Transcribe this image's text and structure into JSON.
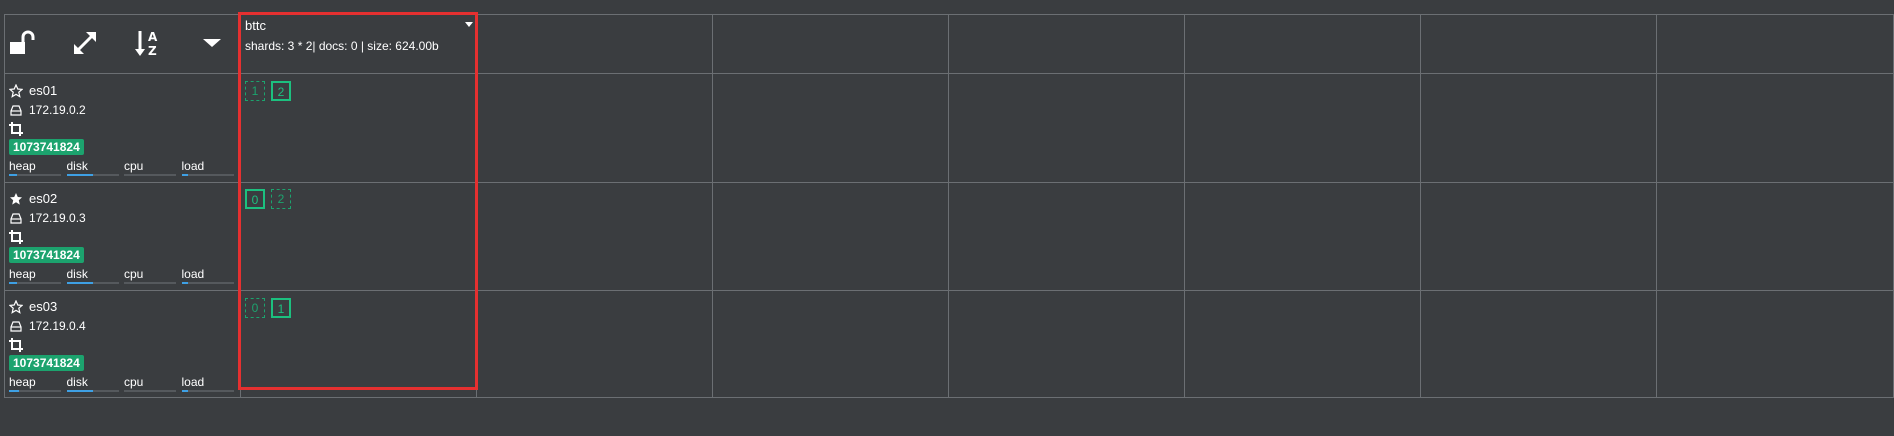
{
  "toolbar": {
    "lock_icon": "unlock-icon",
    "expand_icon": "expand-icon",
    "sort_icon": "sort-az-icon",
    "dropdown_icon": "caret-down-icon"
  },
  "index": {
    "name": "bttc",
    "meta": "shards: 3 * 2| docs: 0 | size: 624.00b"
  },
  "nodes": [
    {
      "name": "es01",
      "master": false,
      "ip": "172.19.0.2",
      "memory": "1073741824",
      "stats": [
        {
          "label": "heap",
          "level": 0.15
        },
        {
          "label": "disk",
          "level": 0.5
        },
        {
          "label": "cpu",
          "level": 0
        },
        {
          "label": "load",
          "level": 0.12
        }
      ],
      "shards": [
        {
          "label": "1",
          "type": "replica"
        },
        {
          "label": "2",
          "type": "primary"
        }
      ]
    },
    {
      "name": "es02",
      "master": true,
      "ip": "172.19.0.3",
      "memory": "1073741824",
      "stats": [
        {
          "label": "heap",
          "level": 0.15
        },
        {
          "label": "disk",
          "level": 0.5
        },
        {
          "label": "cpu",
          "level": 0
        },
        {
          "label": "load",
          "level": 0.12
        }
      ],
      "shards": [
        {
          "label": "0",
          "type": "primary"
        },
        {
          "label": "2",
          "type": "replica"
        }
      ]
    },
    {
      "name": "es03",
      "master": false,
      "ip": "172.19.0.4",
      "memory": "1073741824",
      "stats": [
        {
          "label": "heap",
          "level": 0.2
        },
        {
          "label": "disk",
          "level": 0.5
        },
        {
          "label": "cpu",
          "level": 0
        },
        {
          "label": "load",
          "level": 0.12
        }
      ],
      "shards": [
        {
          "label": "0",
          "type": "replica"
        },
        {
          "label": "1",
          "type": "primary"
        }
      ]
    }
  ],
  "colors": {
    "background": "#3a3d40",
    "primary_shard": "#1cc07f",
    "memory_badge": "#1ca36e",
    "stat_bar": "#3ea0e4",
    "highlight": "#e53030"
  }
}
